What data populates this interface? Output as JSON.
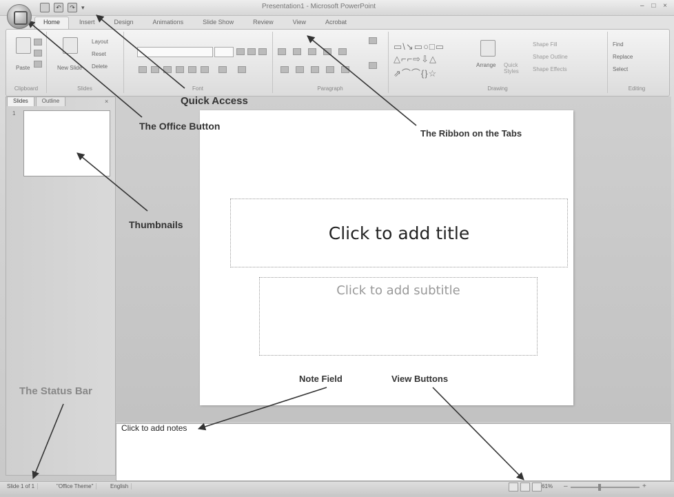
{
  "window": {
    "title": "Presentation1 - Microsoft PowerPoint",
    "controls": "– □ ×"
  },
  "quick_access": {
    "items": [
      "save-icon",
      "undo-icon",
      "redo-icon",
      "customize-icon"
    ],
    "undo": "↶",
    "redo": "↷",
    "customize": "▾"
  },
  "tabs": [
    "Home",
    "Insert",
    "Design",
    "Animations",
    "Slide Show",
    "Review",
    "View",
    "Acrobat"
  ],
  "ribbon": {
    "clipboard": {
      "label": "Clipboard",
      "paste": "Paste"
    },
    "slides": {
      "label": "Slides",
      "new_slide": "New Slide",
      "layout": "Layout",
      "reset": "Reset",
      "delete": "Delete"
    },
    "font": {
      "label": "Font"
    },
    "paragraph": {
      "label": "Paragraph"
    },
    "drawing": {
      "label": "Drawing",
      "arrange": "Arrange",
      "quick_styles": "Quick Styles",
      "shape_fill": "Shape Fill",
      "shape_outline": "Shape Outline",
      "shape_effects": "Shape Effects",
      "shapes_row1": "▭\\↘▭○□▭",
      "shapes_row2": "△⌐⌐⇨⇩△",
      "shapes_row3": "⇗⌒⌒{}☆"
    },
    "editing": {
      "label": "Editing",
      "find": "Find",
      "replace": "Replace",
      "select": "Select"
    }
  },
  "pane": {
    "tabs": [
      "Slides",
      "Outline"
    ],
    "close": "×",
    "slide_number": "1"
  },
  "slide": {
    "title_placeholder": "Click to add title",
    "subtitle_placeholder": "Click to add subtitle"
  },
  "notes": {
    "placeholder": "Click to add notes"
  },
  "status_bar": {
    "slide_info": "Slide 1 of 1",
    "theme": "\"Office Theme\"",
    "language": "English",
    "zoom": "61%",
    "zoom_minus": "–",
    "zoom_plus": "+"
  },
  "annotations": {
    "quick_access": "Quick Access",
    "office_button": "The Office Button",
    "ribbon": "The Ribbon on the Tabs",
    "thumbnails": "Thumbnails",
    "note_field": "Note Field",
    "view_buttons": "View Buttons",
    "status_bar": "The Status Bar"
  }
}
